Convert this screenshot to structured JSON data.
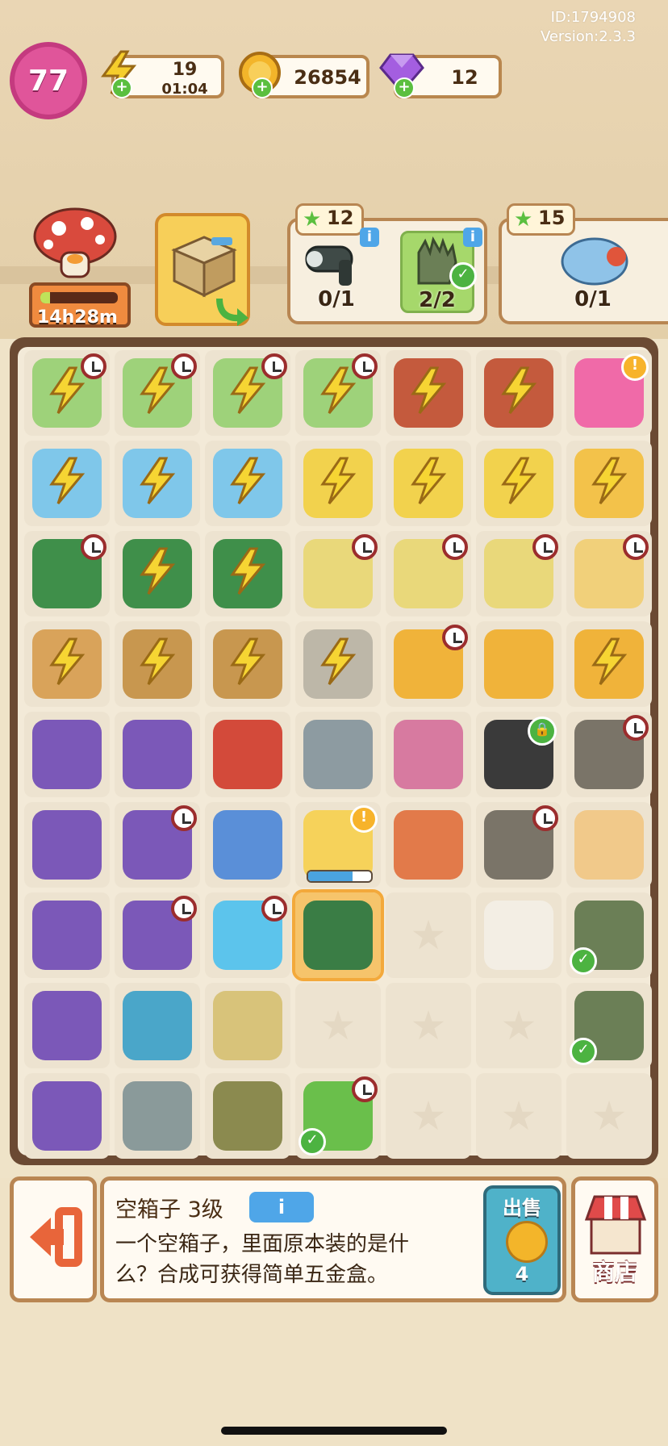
{
  "header": {
    "id_text": "ID:1794908",
    "version_text": "Version:2.3.3",
    "level": "77",
    "energy": {
      "value": "19",
      "timer": "01:04",
      "icon": "lightning-icon"
    },
    "coins": {
      "value": "26854",
      "icon": "coin-icon"
    },
    "gems": {
      "value": "12",
      "icon": "gem-icon"
    }
  },
  "character": {
    "timer": "14h28m",
    "icon": "mushroom-character"
  },
  "orders": [
    {
      "stars": "12",
      "items": [
        {
          "name": "hair-dryer",
          "count": "0/1",
          "done": false
        },
        {
          "name": "gloves",
          "count": "2/2",
          "done": true
        }
      ]
    },
    {
      "stars": "15",
      "items": [
        {
          "name": "fat-goose-gym-sign",
          "count": "0/1",
          "done": false
        }
      ]
    }
  ],
  "board": {
    "rows": [
      [
        "laptop-bolt-clock",
        "laptop-bolt-clock",
        "laptop-bolt-clock",
        "laptop-bolt-clock",
        "wheelbarrow-bolt",
        "wheelbarrow-bolt",
        "backpack-alert"
      ],
      [
        "robot-vacuum-bolt",
        "robot-vacuum-bolt",
        "robot-vacuum-bolt",
        "duck-cart-bolt",
        "duck-cart-bolt",
        "duck-cart-bolt",
        "pineapple-pot-bolt"
      ],
      [
        "toolbox-clock",
        "toolbox-bolt",
        "toolbox-bolt",
        "dumbbell-cart-clock",
        "dumbbell-cart-clock",
        "dumbbell-cart-clock",
        "bucket-clock"
      ],
      [
        "veggie-basket-bolt",
        "basket-bolt",
        "basket-bolt",
        "trophy-bolt",
        "cabinet-clock",
        "cabinet",
        "cabinet-bolt"
      ],
      [
        "camera-crate",
        "camera-crate",
        "key-tag",
        "dumbbell",
        "bricks",
        "black-bag-locked",
        "trash-bag-clock"
      ],
      [
        "camera-crate",
        "camera-crate-clock",
        "mp3-player",
        "duck-float-alert",
        "paint-can",
        "trash-bag-clock",
        "hamster"
      ],
      [
        "camera-crate",
        "camera-crate-clock",
        "pool-float-clock",
        "green-toolbox-selected",
        "empty",
        "mouse",
        "gloves-check"
      ],
      [
        "camera-crate",
        "ramp",
        "sandpaper-roll",
        "empty",
        "empty",
        "empty",
        "gloves-check"
      ],
      [
        "camera-crate",
        "saw",
        "sandbags",
        "potted-tree-clock-check",
        "empty",
        "empty",
        "empty"
      ]
    ],
    "float_progress": 0.7
  },
  "details": {
    "title": "空箱子 3级",
    "info_label": "i",
    "description": "一个空箱子，里面原本装的是什么？合成可获得简单五金盒。",
    "sell_label": "出售",
    "sell_price": "4",
    "shop_label": "商店"
  },
  "colors": {
    "accent_pink": "#e0559a",
    "frame_brown": "#6b4a33",
    "tile_bg": "#ede3d0",
    "check_green": "#4cb341",
    "info_blue": "#4fa6e8"
  }
}
